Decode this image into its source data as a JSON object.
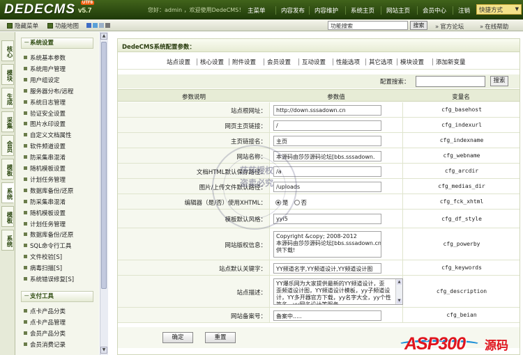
{
  "header": {
    "logo": "DEDECMS",
    "version": "v5.7",
    "badge": "UTF8",
    "welcome": "您好：admin ，欢迎使用DedeCMS！",
    "nav": [
      "主菜单",
      "内容发布",
      "内容维护",
      "系统主页",
      "网站主页",
      "会员中心",
      "注销"
    ],
    "quick": "快捷方式",
    "quick_arrow": "▼"
  },
  "toolbar": {
    "hide_menu": "隐藏菜单",
    "func_map": "功能地图",
    "search_value": "功能搜索",
    "search_button": "搜索",
    "forum": "官方论坛",
    "help": "在线帮助",
    "swatches": [
      "#3f6cc4",
      "#5aa0d8",
      "#9bb0c8",
      "#777777"
    ]
  },
  "vtabs": [
    "核心",
    "模块",
    "生成",
    "采集",
    "会员",
    "模板",
    "系统",
    "模板",
    "系统"
  ],
  "menu": {
    "section1": "系统设置",
    "section1_toggle": "－",
    "items1": [
      "系统基本参数",
      "系统用户管理",
      "用户组设定",
      "服务器分布/远程",
      "系统日志管理",
      "验证安全设置",
      "图片水印设置",
      "自定义文档属性",
      "软件频道设置",
      "防采集串混淆",
      "随机模板设置",
      "计划任务管理",
      "数据库备份/还原",
      "防采集串混淆",
      "随机模板设置",
      "计划任务管理",
      "数据库备份/还原",
      "SQL命令行工具",
      "文件校验[S]",
      "病毒扫描[S]",
      "系统错误修复[S]"
    ],
    "section2": "支付工具",
    "section2_toggle": "－",
    "items2": [
      "点卡产品分类",
      "点卡产品管理",
      "会员产品分类",
      "会员消费记录"
    ]
  },
  "panel": {
    "title": "DedeCMS系统配置参数：",
    "tabs": [
      "站点设置",
      "核心设置",
      "附件设置",
      "会员设置",
      "互动设置",
      "性能选项",
      "其它选项",
      "模块设置",
      "添加新变量"
    ],
    "config_search_label": "配置搜索：",
    "config_search_button": "搜索",
    "col_desc": "参数说明",
    "col_value": "参数值",
    "col_var": "变量名",
    "rows": [
      {
        "label": "站点根网址：",
        "value": "http://down.sssadown.cn",
        "var": "cfg_basehost"
      },
      {
        "label": "网页主页链接：",
        "value": "/",
        "var": "cfg_indexurl"
      },
      {
        "label": "主页链接名：",
        "value": "主页",
        "var": "cfg_indexname"
      },
      {
        "label": "网站名称：",
        "value": "本源码由莎莎源码论坛[bbs.sssadown.",
        "var": "cfg_webname"
      },
      {
        "label": "文档HTML默认保存路径：",
        "value": "/a",
        "var": "cfg_arcdir"
      },
      {
        "label": "图片/上传文件默认路径：",
        "value": "/uploads",
        "var": "cfg_medias_dir"
      },
      {
        "label": "编辑器（是/否）使用XHTML：",
        "value": "",
        "var": "cfg_fck_xhtml"
      },
      {
        "label": "模板默认风格：",
        "value": "yyi5",
        "var": "cfg_df_style"
      },
      {
        "label": "网站版权信息：",
        "value": "",
        "var": "cfg_powerby"
      },
      {
        "label": "站点默认关键字：",
        "value": "YY频道名字,YY频道设计,YY频道设计图",
        "var": "cfg_keywords"
      },
      {
        "label": "站点描述：",
        "value": "",
        "var": "cfg_description"
      },
      {
        "label": "网站备案号：",
        "value": "备案中.....",
        "var": "cfg_beian"
      }
    ],
    "xhtml_yes": "是",
    "xhtml_no": "否",
    "copyright_lines": [
      "Copyright &copy; 2008-2012",
      "本源码由莎莎源码论坛[bbs.sssadown.cn]提",
      "供下载!"
    ],
    "desc_lines": [
      "YY爆乐网为大家提供最新的YY频道设计，歪",
      "歪频道设计图，YY频道设计模板，yy子频道设",
      "计，YY多开器官方下载，yy名字大全，yy个性",
      "签名，yy网名设计等服务"
    ],
    "confirm": "确定",
    "reset": "重置"
  },
  "watermark": {
    "line1": "莎莎授权",
    "line2": "盗卖必究",
    "ring": "莎莎源码论坛 bbs.sssadown.cn"
  },
  "corner_logo": {
    "brand": "ASP300",
    "suffix": "源码"
  }
}
